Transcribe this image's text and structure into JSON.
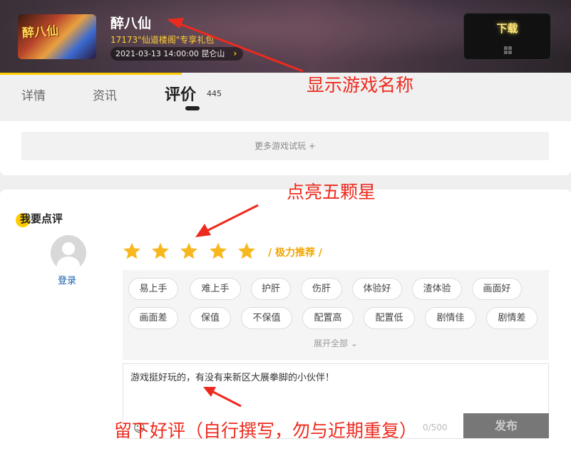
{
  "header": {
    "game_logo_text": "醉八仙",
    "game_title": "醉八仙",
    "gift": "17173\"仙道楼阁\"专享礼包",
    "server": "2021-03-13 14:00:00 昆仑山",
    "download_label": "下载",
    "platform_icon": "windows-icon"
  },
  "tabs": {
    "details": "详情",
    "news": "资讯",
    "reviews": "评价",
    "reviews_count": "445"
  },
  "more_games": "更多游戏试玩 +",
  "review": {
    "section_title": "我要点评",
    "login": "登录",
    "rating": {
      "stars": 5,
      "max": 5,
      "label": "/ 极力推荐 /"
    },
    "star_color": "#f7b71d",
    "tags": [
      "易上手",
      "难上手",
      "护肝",
      "伤肝",
      "体验好",
      "渣体验",
      "画面好",
      "画面差",
      "保值",
      "不保值",
      "配置高",
      "配置低",
      "剧情佳",
      "剧情差"
    ],
    "expand_label": "展开全部",
    "comment": "游戏挺好玩的，有没有来新区大展拳脚的小伙伴！",
    "emoji_icon": "smiley-icon",
    "char_count": "0/500",
    "publish": "发布"
  },
  "annotations": {
    "game_name": "显示游戏名称",
    "stars": "点亮五颗星",
    "review": "留下好评（自行撰写，勿与近期重复）",
    "color": "#ee2a1e"
  }
}
